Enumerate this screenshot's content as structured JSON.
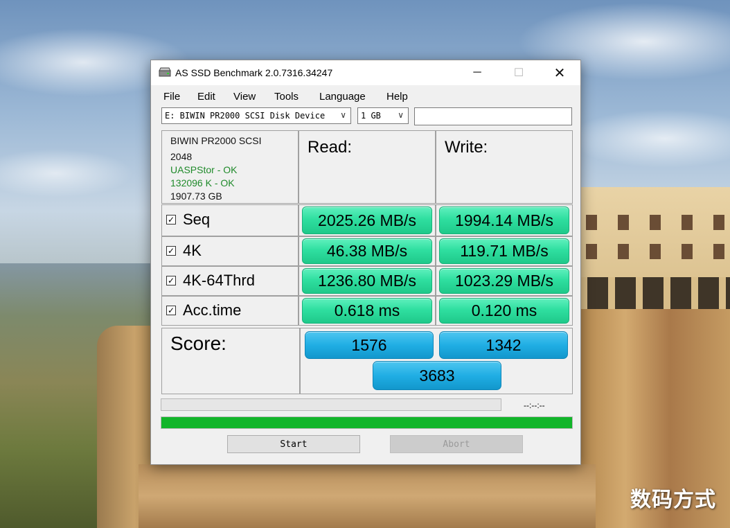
{
  "window": {
    "title": "AS SSD Benchmark 2.0.7316.34247",
    "minimize_glyph": "─",
    "maximize_glyph": "☐",
    "close_glyph": "✕"
  },
  "menu": {
    "items": [
      "File",
      "Edit",
      "View",
      "Tools",
      "Language",
      "Help"
    ]
  },
  "toolbar": {
    "drive": "E: BIWIN PR2000 SCSI Disk Device",
    "size": "1 GB",
    "chevron": "∨"
  },
  "device_info": {
    "name": "BIWIN PR2000 SCSI",
    "block": "2048",
    "driver_status": "UASPStor - OK",
    "alignment_status": "132096 K - OK",
    "capacity": "1907.73 GB"
  },
  "columns": {
    "read": "Read:",
    "write": "Write:"
  },
  "tests": [
    {
      "label": "Seq",
      "checked": true,
      "read": "2025.26 MB/s",
      "write": "1994.14 MB/s"
    },
    {
      "label": "4K",
      "checked": true,
      "read": "46.38 MB/s",
      "write": "119.71 MB/s"
    },
    {
      "label": "4K-64Thrd",
      "checked": true,
      "read": "1236.80 MB/s",
      "write": "1023.29 MB/s"
    },
    {
      "label": "Acc.time",
      "checked": true,
      "read": "0.618 ms",
      "write": "0.120 ms"
    }
  ],
  "checkbox_mark": "✓",
  "score": {
    "label": "Score:",
    "read": "1576",
    "write": "1342",
    "total": "3683"
  },
  "progress": {
    "time": "--:--:--",
    "current_fraction": 0,
    "overall_fraction": 1.0,
    "fill_color": "#12b52a"
  },
  "buttons": {
    "start": "Start",
    "abort": "Abort"
  },
  "watermark": "数码方式",
  "colors": {
    "result_green": "#2fdfa0",
    "score_blue": "#20aee4",
    "ok_green": "#1f8a2a"
  }
}
